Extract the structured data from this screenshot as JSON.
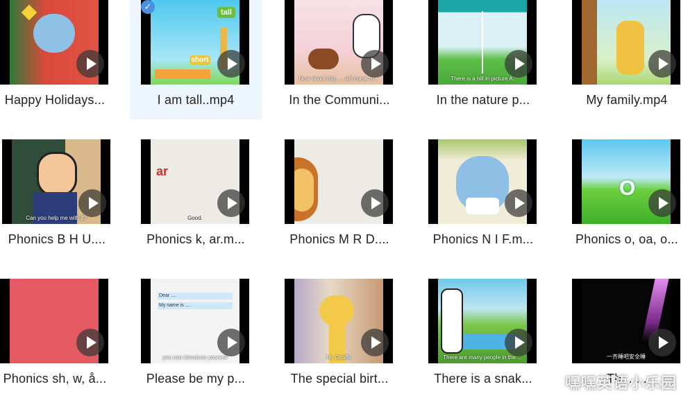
{
  "files": [
    {
      "name": "Happy Holidays..."
    },
    {
      "name": "I am tall..mp4",
      "selected": true,
      "thumb_texts": [
        "tall",
        "short"
      ]
    },
    {
      "name": "In the Communi...",
      "subtitle": "Now about this, ... will come to..."
    },
    {
      "name": "In the nature p...",
      "subtitle": "There is a hill in picture A."
    },
    {
      "name": "My family.mp4"
    },
    {
      "name": "Phonics B H U....",
      "subtitle": "Can you help me with it?"
    },
    {
      "name": "Phonics k, ar.m...",
      "thumb_texts": [
        "ar"
      ],
      "subtitle": "Good."
    },
    {
      "name": "Phonics M R D...."
    },
    {
      "name": "Phonics N I F.m..."
    },
    {
      "name": "Phonics o, oa, o...",
      "thumb_texts": [
        "O"
      ]
    },
    {
      "name": "Phonics sh, w, å..."
    },
    {
      "name": "Please be my p...",
      "thumb_texts": [
        "Dear ....",
        "My name is ...."
      ],
      "subtitle": "you can introduce yourself"
    },
    {
      "name": "The special birt...",
      "subtitle": "Hi, Giraffe"
    },
    {
      "name": "There is a snak...",
      "subtitle": "There are many people in the ..."
    },
    {
      "name": "Th... ...",
      "subtitle": "一齐睡吧安全睡"
    }
  ],
  "watermark": "嘿嘿英语小乐园",
  "icons": {
    "play": "play-icon",
    "check": "check-icon"
  }
}
